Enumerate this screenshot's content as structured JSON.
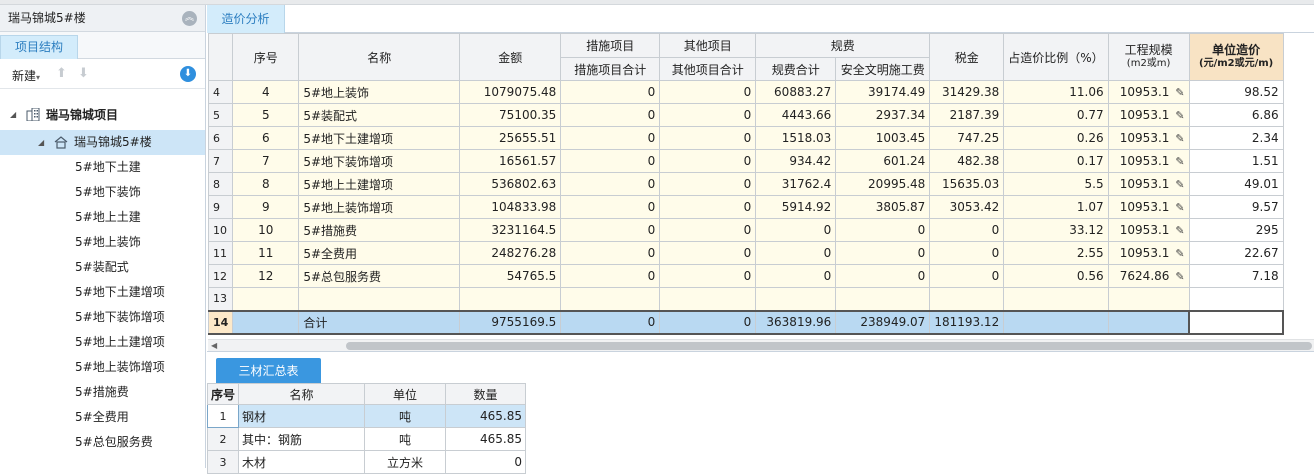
{
  "left_panel": {
    "title": "瑞马锦城5#楼",
    "tab": "项目结构",
    "toolbar": {
      "new_label": "新建"
    },
    "tree": {
      "project": "瑞马锦城项目",
      "building": "瑞马锦城5#楼",
      "items": [
        "5#地下土建",
        "5#地下装饰",
        "5#地上土建",
        "5#地上装饰",
        "5#装配式",
        "5#地下土建增项",
        "5#地下装饰增项",
        "5#地上土建增项",
        "5#地上装饰增项",
        "5#措施费",
        "5#全费用",
        "5#总包服务费"
      ]
    }
  },
  "main_tab": "造价分析",
  "grid": {
    "headers": {
      "seq": "序号",
      "name": "名称",
      "amount": "金额",
      "measures_group": "措施项目",
      "measures_total": "措施项目合计",
      "other_group": "其他项目",
      "other_total": "其他项目合计",
      "fees_group": "规费",
      "fees_total": "规费合计",
      "safety_fee": "安全文明施工费",
      "tax": "税金",
      "ratio": "占造价比例（%）",
      "scale_line1": "工程规模",
      "scale_line2": "(m2或m)",
      "unit_price_line1": "单位造价",
      "unit_price_line2": "(元/m2或元/m)"
    },
    "rows": [
      {
        "rn": "4",
        "seq": "4",
        "name": "5#地上装饰",
        "amount": "1079075.48",
        "measures": "0",
        "other": "0",
        "fees": "60883.27",
        "safety": "39174.49",
        "tax": "31429.38",
        "ratio": "11.06",
        "scale": "10953.1",
        "unit": "98.52"
      },
      {
        "rn": "5",
        "seq": "5",
        "name": "5#装配式",
        "amount": "75100.35",
        "measures": "0",
        "other": "0",
        "fees": "4443.66",
        "safety": "2937.34",
        "tax": "2187.39",
        "ratio": "0.77",
        "scale": "10953.1",
        "unit": "6.86"
      },
      {
        "rn": "6",
        "seq": "6",
        "name": "5#地下土建增项",
        "amount": "25655.51",
        "measures": "0",
        "other": "0",
        "fees": "1518.03",
        "safety": "1003.45",
        "tax": "747.25",
        "ratio": "0.26",
        "scale": "10953.1",
        "unit": "2.34"
      },
      {
        "rn": "7",
        "seq": "7",
        "name": "5#地下装饰增项",
        "amount": "16561.57",
        "measures": "0",
        "other": "0",
        "fees": "934.42",
        "safety": "601.24",
        "tax": "482.38",
        "ratio": "0.17",
        "scale": "10953.1",
        "unit": "1.51"
      },
      {
        "rn": "8",
        "seq": "8",
        "name": "5#地上土建增项",
        "amount": "536802.63",
        "measures": "0",
        "other": "0",
        "fees": "31762.4",
        "safety": "20995.48",
        "tax": "15635.03",
        "ratio": "5.5",
        "scale": "10953.1",
        "unit": "49.01"
      },
      {
        "rn": "9",
        "seq": "9",
        "name": "5#地上装饰增项",
        "amount": "104833.98",
        "measures": "0",
        "other": "0",
        "fees": "5914.92",
        "safety": "3805.87",
        "tax": "3053.42",
        "ratio": "1.07",
        "scale": "10953.1",
        "unit": "9.57"
      },
      {
        "rn": "10",
        "seq": "10",
        "name": "5#措施费",
        "amount": "3231164.5",
        "measures": "0",
        "other": "0",
        "fees": "0",
        "safety": "0",
        "tax": "0",
        "ratio": "33.12",
        "scale": "10953.1",
        "unit": "295"
      },
      {
        "rn": "11",
        "seq": "11",
        "name": "5#全费用",
        "amount": "248276.28",
        "measures": "0",
        "other": "0",
        "fees": "0",
        "safety": "0",
        "tax": "0",
        "ratio": "2.55",
        "scale": "10953.1",
        "unit": "22.67"
      },
      {
        "rn": "12",
        "seq": "12",
        "name": "5#总包服务费",
        "amount": "54765.5",
        "measures": "0",
        "other": "0",
        "fees": "0",
        "safety": "0",
        "tax": "0",
        "ratio": "0.56",
        "scale": "7624.86",
        "unit": "7.18"
      }
    ],
    "empty_row_rn": "13",
    "total": {
      "rn": "14",
      "name": "合计",
      "amount": "9755169.5",
      "measures": "0",
      "other": "0",
      "fees": "363819.96",
      "safety": "238949.07",
      "tax": "181193.12"
    }
  },
  "bottom": {
    "tab": "三材汇总表",
    "headers": {
      "seq": "序号",
      "name": "名称",
      "unit": "单位",
      "qty": "数量"
    },
    "rows": [
      {
        "rn": "1",
        "name": "钢材",
        "unit": "吨",
        "qty": "465.85"
      },
      {
        "rn": "2",
        "name": "其中：钢筋",
        "unit": "吨",
        "qty": "465.85"
      },
      {
        "rn": "3",
        "name": "木材",
        "unit": "立方米",
        "qty": "0"
      }
    ]
  },
  "colors": {
    "accent": "#3a97e0",
    "tab_bg": "#d3ecfb",
    "row_bg": "#fffcea",
    "total_bg": "#b9d9f2",
    "unit_header_bg": "#f8e3c4"
  }
}
